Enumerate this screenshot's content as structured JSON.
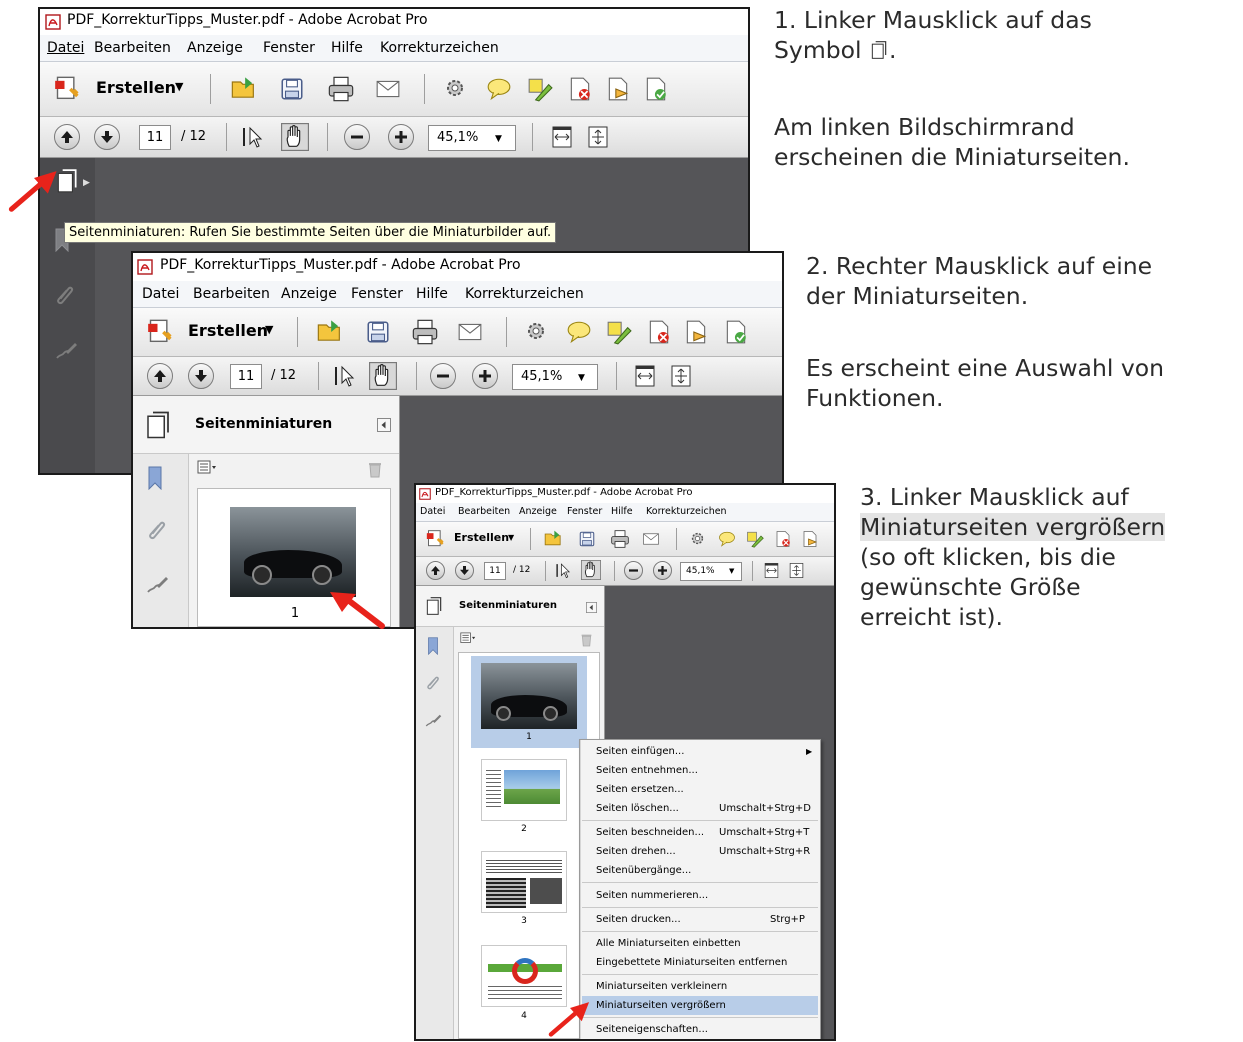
{
  "window": {
    "title": "PDF_KorrekturTipps_Muster.pdf - Adobe Acrobat Pro",
    "menu": [
      "Datei",
      "Bearbeiten",
      "Anzeige",
      "Fenster",
      "Hilfe",
      "Korrekturzeichen"
    ],
    "create_label": "Erstellen",
    "page_current": "11",
    "page_total": "/ 12",
    "zoom": "45,1%"
  },
  "tooltip": "Seitenminiaturen: Rufen Sie bestimmte Seiten über die Miniaturbilder auf.",
  "thumbnails_panel": {
    "title": "Seitenminiaturen",
    "pages": [
      "1",
      "2",
      "3",
      "4"
    ]
  },
  "context_menu": {
    "items": [
      {
        "label": "Seiten einfügen...",
        "shortcut": "",
        "submenu": true
      },
      {
        "label": "Seiten entnehmen...",
        "shortcut": ""
      },
      {
        "label": "Seiten ersetzen...",
        "shortcut": ""
      },
      {
        "label": "Seiten löschen...",
        "shortcut": "Umschalt+Strg+D"
      },
      {
        "label": "Seiten beschneiden...",
        "shortcut": "Umschalt+Strg+T"
      },
      {
        "label": "Seiten drehen...",
        "shortcut": "Umschalt+Strg+R"
      },
      {
        "label": "Seitenübergänge...",
        "shortcut": ""
      },
      {
        "label": "Seiten nummerieren...",
        "shortcut": ""
      },
      {
        "label": "Seiten drucken...",
        "shortcut": "Strg+P"
      },
      {
        "label": "Alle Miniaturseiten einbetten",
        "shortcut": ""
      },
      {
        "label": "Eingebettete Miniaturseiten entfernen",
        "shortcut": ""
      },
      {
        "label": "Miniaturseiten verkleinern",
        "shortcut": ""
      },
      {
        "label": "Miniaturseiten vergrößern",
        "shortcut": "",
        "highlighted": true
      },
      {
        "label": "Seiteneigenschaften...",
        "shortcut": ""
      }
    ]
  },
  "instructions": {
    "step1_line1": "1. Linker Mausklick auf das",
    "step1_line2": "Symbol",
    "step1_note_line1": "Am linken Bildschirmrand",
    "step1_note_line2": "erscheinen die Miniaturseiten.",
    "step2_line1": "2. Rechter Mausklick auf eine",
    "step2_line2": "der Miniaturseiten.",
    "step2_note_line1": "Es erscheint eine Auswahl von",
    "step2_note_line2": "Funktionen.",
    "step3_line1": "3. Linker Mausklick auf",
    "step3_line2": "Miniaturseiten vergrößern",
    "step3_line3": "(so oft klicken, bis die",
    "step3_line4": "gewünschte Größe",
    "step3_line5": "erreicht ist)."
  },
  "colors": {
    "arrow": "#e8231b",
    "dark_bg": "#555558",
    "menu_highlight": "#b8cde8"
  }
}
